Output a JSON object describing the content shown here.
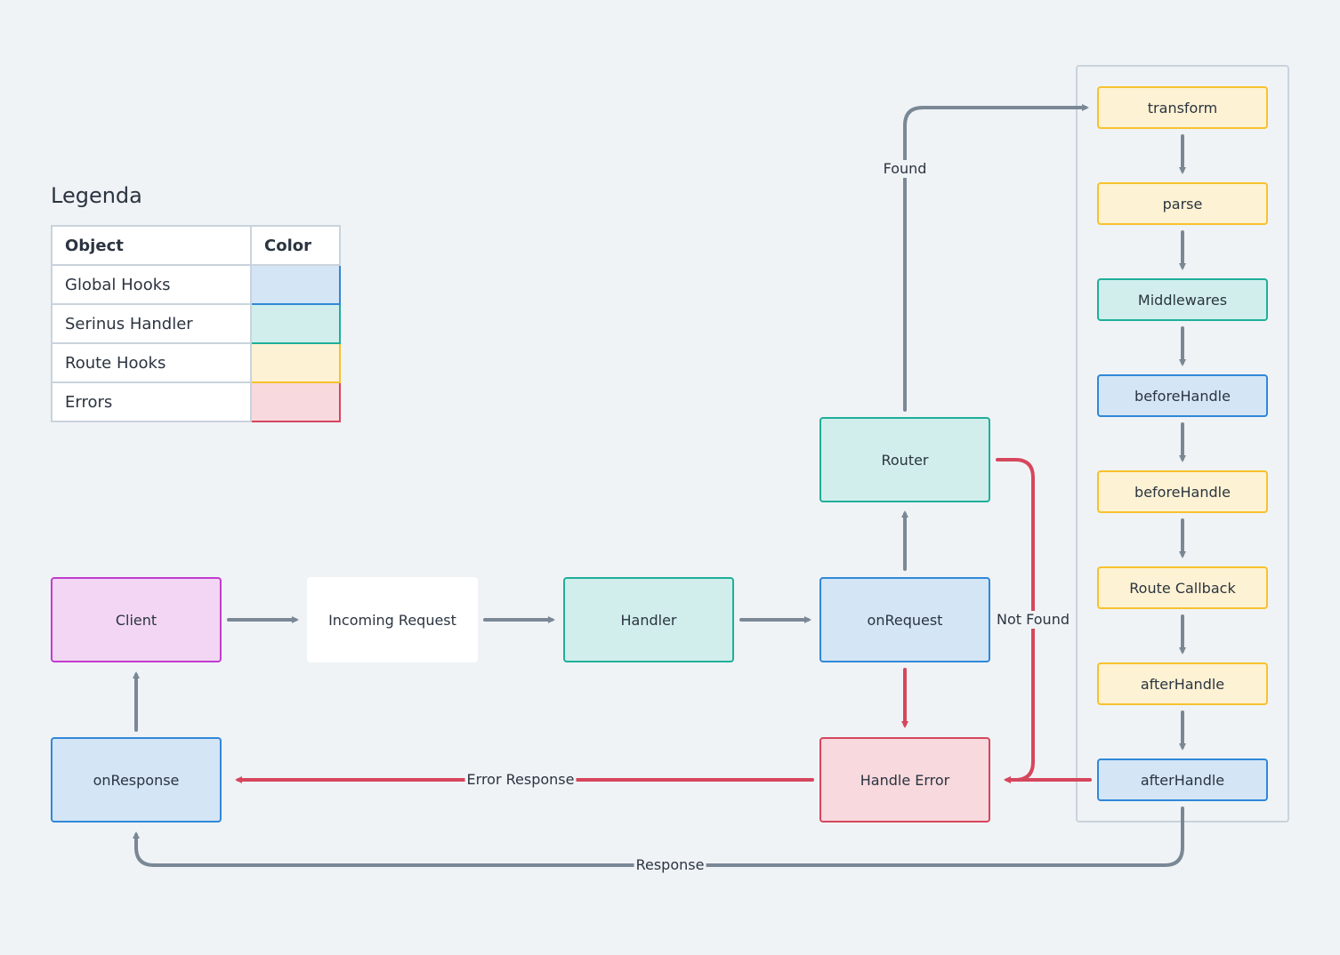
{
  "legend": {
    "title": "Legenda",
    "headers": {
      "object": "Object",
      "color": "Color"
    },
    "rows": [
      {
        "label": "Global Hooks",
        "category": "global",
        "fill": "#d4e5f5",
        "stroke": "#2f88d8"
      },
      {
        "label": "Serinus Handler",
        "category": "serinus",
        "fill": "#d1eeec",
        "stroke": "#1eaf99"
      },
      {
        "label": "Route Hooks",
        "category": "route",
        "fill": "#fdf2d3",
        "stroke": "#f7c22e"
      },
      {
        "label": "Errors",
        "category": "error",
        "fill": "#f7d9de",
        "stroke": "#d6465d"
      }
    ]
  },
  "nodes": {
    "client": "Client",
    "incoming_request": "Incoming Request",
    "handler": "Handler",
    "on_request": "onRequest",
    "router": "Router",
    "handle_error": "Handle Error",
    "on_response": "onResponse",
    "lifecycle": [
      {
        "label": "transform",
        "category": "route"
      },
      {
        "label": "parse",
        "category": "route"
      },
      {
        "label": "Middlewares",
        "category": "serinus"
      },
      {
        "label": "beforeHandle",
        "category": "global"
      },
      {
        "label": "beforeHandle",
        "category": "route"
      },
      {
        "label": "Route Callback",
        "category": "route"
      },
      {
        "label": "afterHandle",
        "category": "route"
      },
      {
        "label": "afterHandle",
        "category": "global"
      }
    ]
  },
  "edge_labels": {
    "found": "Found",
    "not_found": "Not Found",
    "error_response": "Error Response",
    "response": "Response"
  },
  "colors": {
    "flow": "#7a8896",
    "error_flow": "#d6465d",
    "background": "#f0f3f6"
  }
}
